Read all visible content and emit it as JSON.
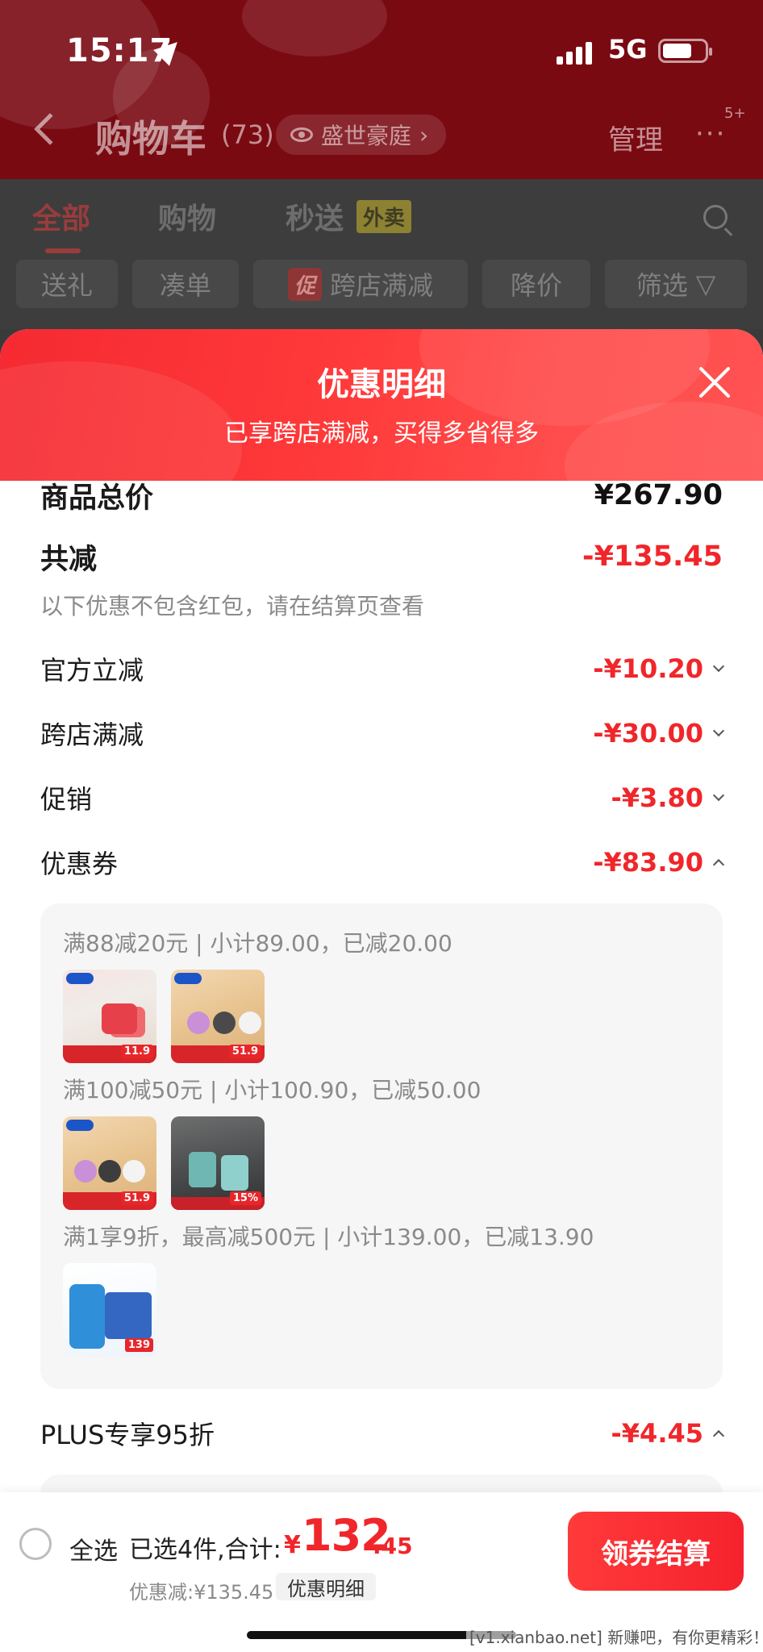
{
  "status_bar": {
    "time": "15:17",
    "network": "5G"
  },
  "nav": {
    "title": "购物车",
    "count": "(73)",
    "chip_label": "盛世豪庭",
    "manage": "管理",
    "more": "···",
    "badge": "5+"
  },
  "tabs": {
    "all": "全部",
    "shopping": "购物",
    "instant": "秒送",
    "waimai": "外卖"
  },
  "filters": {
    "gift": "送礼",
    "bundle": "凑单",
    "promo_tag": "促",
    "cross_store": "跨店满减",
    "price_drop": "降价",
    "filter": "筛选"
  },
  "sheet": {
    "title": "优惠明细",
    "subtitle": "已享跨店满减，买得多省得多",
    "total_label": "商品总价",
    "total_value": "¥267.90",
    "reduced_label": "共减",
    "reduced_value": "-¥135.45",
    "note": "以下优惠不包含红包，请在结算页查看",
    "lines": [
      {
        "label": "官方立减",
        "value": "-¥10.20"
      },
      {
        "label": "跨店满减",
        "value": "-¥30.00"
      },
      {
        "label": "促销",
        "value": "-¥3.80"
      },
      {
        "label": "优惠券",
        "value": "-¥83.90"
      }
    ],
    "coupons": [
      {
        "text": "满88减20元 | 小计89.00，已减20.00",
        "tag_a": "11.9",
        "tag_b": "51.9"
      },
      {
        "text": "满100减50元 | 小计100.90，已减50.00",
        "tag_a": "51.9",
        "tag_b": "15%"
      },
      {
        "text": "满1享9折，最高减500元 | 小计139.00，已减13.90",
        "tag_a": "139"
      }
    ],
    "plus_label": "PLUS专享95折",
    "plus_value": "-¥4.45"
  },
  "bottom_bar": {
    "select_all": "全选",
    "selected": "已选4件,合计:",
    "currency": "¥",
    "total_int": "132",
    "total_dec": ".45",
    "discount": "优惠减:¥135.45",
    "detail": "优惠明细",
    "checkout": "领券结算",
    "watermark": "[v1.xianbao.net] 新赚吧，有你更精彩！"
  },
  "colors": {
    "accent": "#f0262a",
    "header_dim": "#7a0a12"
  }
}
